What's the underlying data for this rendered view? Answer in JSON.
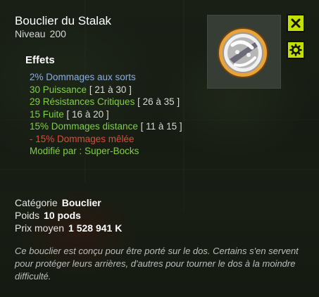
{
  "item": {
    "name": "Bouclier du Stalak",
    "level_label": "Niveau",
    "level_value": "200"
  },
  "effects": {
    "heading": "Effets",
    "lines": [
      {
        "text": "2% Dommages aux sorts",
        "range": "",
        "color": "#8aaee8"
      },
      {
        "text": "30 Puissance",
        "range": "[ 21 à 30 ]",
        "color": "#7fd043"
      },
      {
        "text": "29 Résistances Critiques",
        "range": "[ 26 à 35 ]",
        "color": "#7fd043"
      },
      {
        "text": "15 Fuite",
        "range": "[ 16 à 20 ]",
        "color": "#7fd043"
      },
      {
        "text": "15% Dommages distance",
        "range": "[ 11 à 15 ]",
        "color": "#7fd043"
      },
      {
        "text": "- 15% Dommages mêlée",
        "range": "",
        "color": "#e04a3a"
      }
    ],
    "modified_by_label": "Modifié par :",
    "modified_by_value": "Super-Bocks"
  },
  "details": {
    "category_label": "Catégorie",
    "category_value": "Bouclier",
    "weight_label": "Poids",
    "weight_value": "10 pods",
    "price_label": "Prix moyen",
    "price_value": "1 528 941 K"
  },
  "description": "Ce bouclier est conçu pour être porté sur le dos. Certains s'en servent pour protéger leurs arrières, d'autres pour tourner le dos à la moindre difficulté.",
  "colors": {
    "accent": "#c4e000",
    "effect_blue": "#8aaee8",
    "effect_green": "#7fd043",
    "effect_red": "#e04a3a"
  },
  "icons": {
    "close": "close-icon",
    "settings": "gear-icon",
    "item": "shield-item-icon"
  }
}
